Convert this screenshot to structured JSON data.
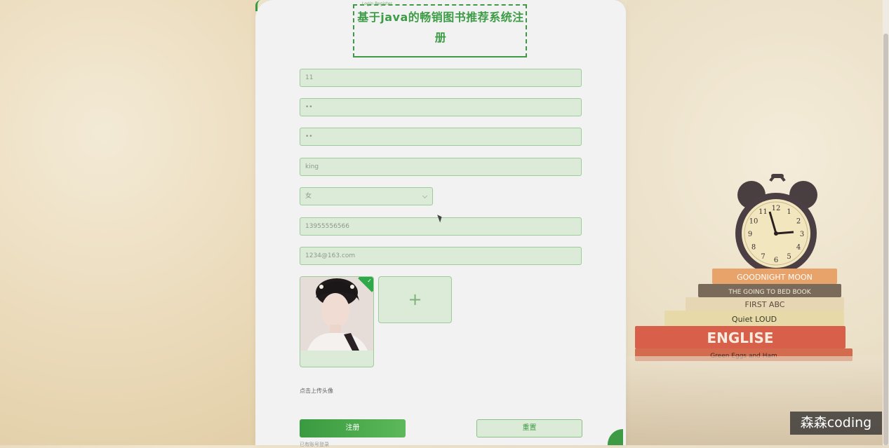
{
  "page": {
    "title": "基于java的畅销图书推荐系统注册",
    "title_tag": "Login Register",
    "accent_color": "#3f9a45"
  },
  "form": {
    "fields": [
      {
        "name": "username",
        "value": "11"
      },
      {
        "name": "password",
        "value": "••"
      },
      {
        "name": "confirm-password",
        "value": "••"
      },
      {
        "name": "name",
        "value": "king"
      },
      {
        "name": "phone",
        "value": "13955556566"
      },
      {
        "name": "email",
        "value": "1234@163.com"
      }
    ],
    "gender": {
      "selected": "女",
      "icon": "chevron-down-icon"
    },
    "avatar": {
      "hint": "点击上传头像",
      "upload_icon": "plus-icon",
      "status_icon": "check-icon"
    },
    "buttons": {
      "register": "注册",
      "reset": "重置"
    },
    "login_link": "已有账号登录"
  },
  "decor": {
    "clock": {
      "numerals": [
        "12",
        "1",
        "2",
        "3",
        "4",
        "5",
        "6",
        "7",
        "8",
        "9",
        "10",
        "11"
      ]
    },
    "books": [
      {
        "text": "GOODNIGHT MOON",
        "color": "#e7a36a"
      },
      {
        "text": "THE GOING TO BED BOOK",
        "color": "#7a6a5a"
      },
      {
        "text": "FIRST  ABC",
        "color": "#e6d6b4"
      },
      {
        "text": "Quiet LOUD",
        "color": "#e8d9a8"
      },
      {
        "text": "ENGLISE",
        "color": "#d8604a"
      },
      {
        "text": "Green Eggs and Ham",
        "color": "#d36b4f"
      }
    ]
  },
  "watermark": "森森coding"
}
